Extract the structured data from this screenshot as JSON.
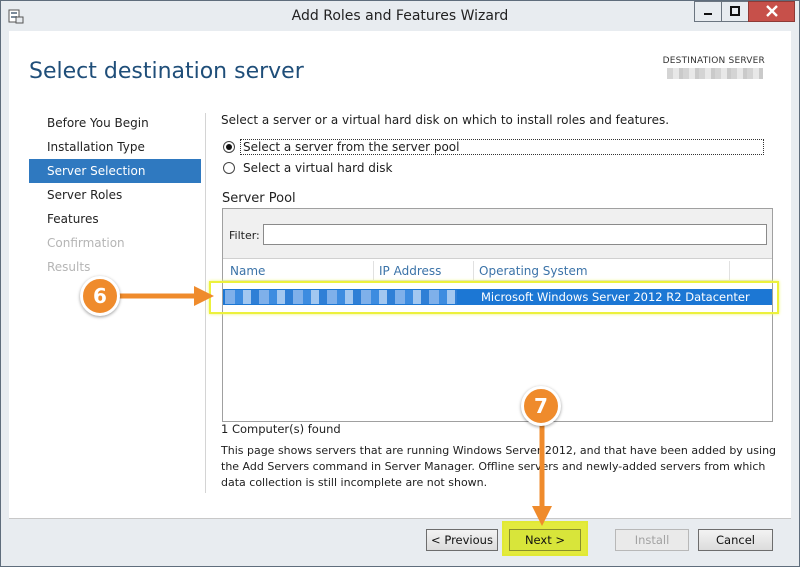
{
  "window": {
    "title": "Add Roles and Features Wizard"
  },
  "header": {
    "page_title": "Select destination server",
    "destination_label": "DESTINATION SERVER"
  },
  "nav": {
    "items": [
      {
        "label": "Before You Begin",
        "state": "normal"
      },
      {
        "label": "Installation Type",
        "state": "normal"
      },
      {
        "label": "Server Selection",
        "state": "active"
      },
      {
        "label": "Server Roles",
        "state": "normal"
      },
      {
        "label": "Features",
        "state": "normal"
      },
      {
        "label": "Confirmation",
        "state": "disabled"
      },
      {
        "label": "Results",
        "state": "disabled"
      }
    ]
  },
  "main": {
    "intro": "Select a server or a virtual hard disk on which to install roles and features.",
    "options": [
      {
        "label": "Select a server from the server pool",
        "selected": true
      },
      {
        "label": "Select a virtual hard disk",
        "selected": false
      }
    ],
    "pool_label": "Server Pool",
    "filter_label": "Filter:",
    "filter_value": "",
    "columns": [
      "Name",
      "IP Address",
      "Operating System"
    ],
    "rows": [
      {
        "name": "",
        "ip": "",
        "os": "Microsoft Windows Server 2012 R2 Datacenter",
        "selected": true
      }
    ],
    "found_text": "1 Computer(s) found",
    "note": "This page shows servers that are running Windows Server 2012, and that have been added by using the Add Servers command in Server Manager. Offline servers and newly-added servers from which data collection is still incomplete are not shown."
  },
  "footer": {
    "previous": "< Previous",
    "next": "Next >",
    "install": "Install",
    "cancel": "Cancel"
  },
  "annotations": {
    "step_a": "6",
    "step_b": "7",
    "accent": "#ef8b2c",
    "highlight": "#ecf13c"
  }
}
